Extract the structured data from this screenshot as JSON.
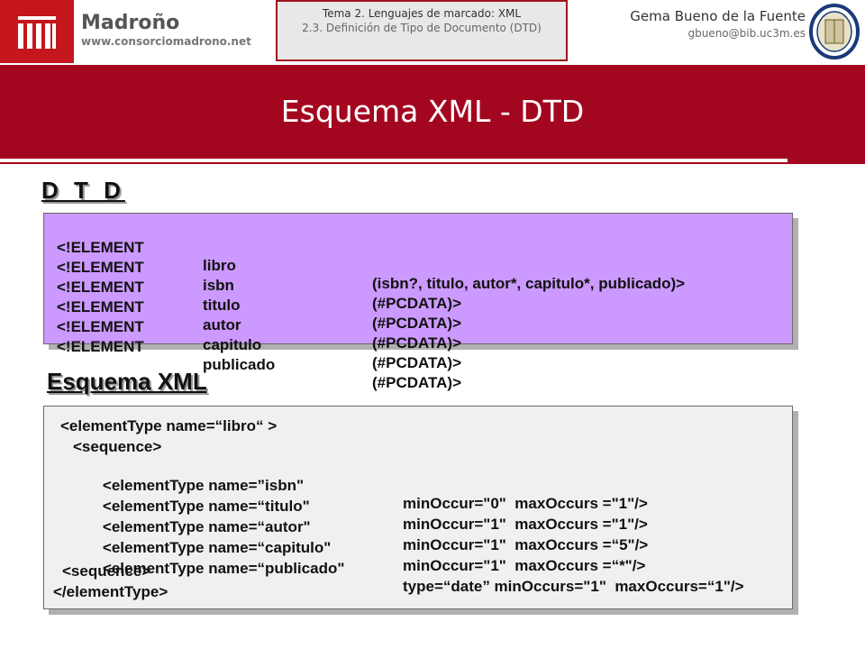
{
  "header": {
    "logo_name": "Madroño",
    "logo_url": "www.consorciomadrono.net",
    "topic_title": "Tema 2. Lenguajes de marcado: XML",
    "topic_subtitle": "2.3. Definición de Tipo de Documento (DTD)",
    "author_name": "Gema Bueno de la Fuente",
    "author_email": "gbueno@bib.uc3m.es"
  },
  "banner": {
    "title": "Esquema XML - DTD"
  },
  "dtd": {
    "heading": "D T D",
    "rows": [
      {
        "kw": "<!ELEMENT",
        "name": "libro",
        "def": "(isbn?, titulo, autor*, capitulo*, publicado)>"
      },
      {
        "kw": "<!ELEMENT",
        "name": "isbn",
        "def": "(#PCDATA)>"
      },
      {
        "kw": "<!ELEMENT",
        "name": "titulo",
        "def": "(#PCDATA)>"
      },
      {
        "kw": "<!ELEMENT",
        "name": "autor",
        "def": "(#PCDATA)>"
      },
      {
        "kw": "<!ELEMENT",
        "name": "capitulo",
        "def": "(#PCDATA)>"
      },
      {
        "kw": "<!ELEMENT",
        "name": "publicado",
        "def": "(#PCDATA)>"
      }
    ]
  },
  "schema": {
    "heading": "Esquema XML",
    "line_open": "<elementType name=“libro“ >",
    "seq_open": "<sequence>",
    "elements": [
      {
        "name": "<elementType name=”isbn\"",
        "occ": "minOccur=\"0\"  maxOccurs =\"1\"/>"
      },
      {
        "name": "<elementType name=“titulo\"",
        "occ": "minOccur=\"1\"  maxOccurs =\"1\"/>"
      },
      {
        "name": "<elementType name=“autor\"",
        "occ": "minOccur=\"1\"  maxOccurs =“5\"/>"
      },
      {
        "name": "<elementType name=“capitulo\"",
        "occ": "minOccur=\"1\"  maxOccurs =“*\"/>"
      },
      {
        "name": "<elementType name=“publicado\"",
        "occ": "type=“date” minOccurs=\"1\"  maxOccurs=“1\"/>"
      }
    ],
    "seq_close": "<sequence>",
    "line_close": "</elementType>"
  },
  "colors": {
    "banner": "#a3071f",
    "dtd_box": "#cc99ff",
    "xml_box": "#f0f0f0",
    "logo": "#c4161c"
  },
  "icons": {
    "logo": "madrono-logo-icon",
    "seal": "university-seal-icon"
  }
}
